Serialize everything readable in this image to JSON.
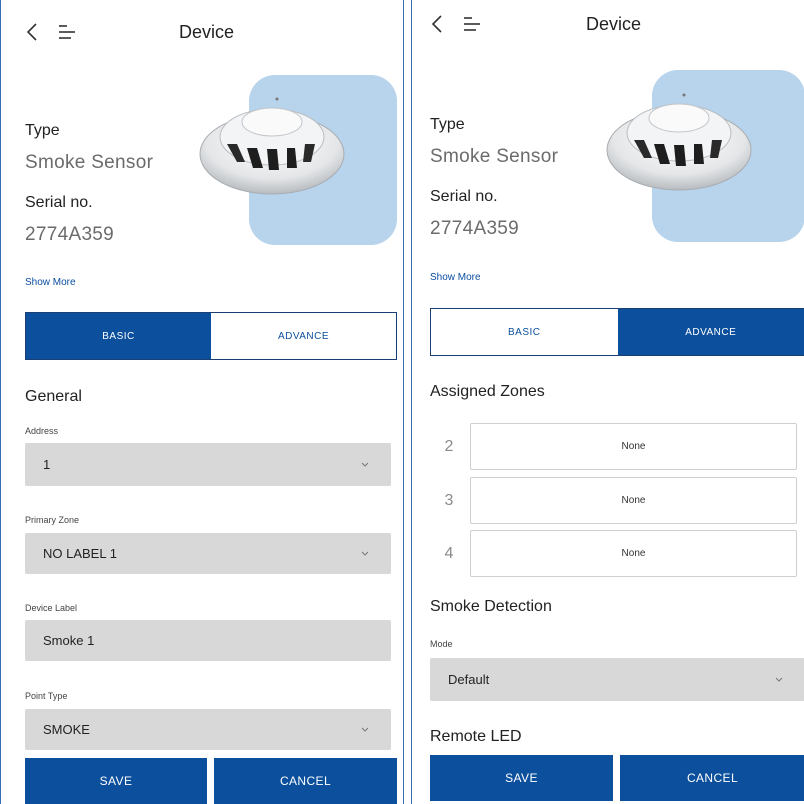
{
  "left": {
    "header": {
      "title": "Device"
    },
    "device": {
      "type_label": "Type",
      "type_value": "Smoke Sensor",
      "serial_label": "Serial no.",
      "serial_value": "2774A359",
      "show_more": "Show More"
    },
    "tabs": {
      "basic": "BASIC",
      "advance": "ADVANCE",
      "active": "basic"
    },
    "general": {
      "title": "General",
      "address_label": "Address",
      "address_value": "1",
      "primary_zone_label": "Primary Zone",
      "primary_zone_value": "NO LABEL 1",
      "device_label_label": "Device Label",
      "device_label_value": "Smoke 1",
      "point_type_label": "Point Type",
      "point_type_value": "SMOKE"
    },
    "buttons": {
      "save": "SAVE",
      "cancel": "CANCEL"
    }
  },
  "right": {
    "header": {
      "title": "Device"
    },
    "device": {
      "type_label": "Type",
      "type_value": "Smoke Sensor",
      "serial_label": "Serial no.",
      "serial_value": "2774A359",
      "show_more": "Show More"
    },
    "tabs": {
      "basic": "BASIC",
      "advance": "ADVANCE",
      "active": "advance"
    },
    "assigned_zones": {
      "title": "Assigned Zones",
      "zones": [
        {
          "number": "2",
          "value": "None"
        },
        {
          "number": "3",
          "value": "None"
        },
        {
          "number": "4",
          "value": "None"
        }
      ]
    },
    "smoke_detection": {
      "title": "Smoke Detection",
      "mode_label": "Mode",
      "mode_value": "Default"
    },
    "remote_led": {
      "title": "Remote LED"
    },
    "buttons": {
      "save": "SAVE",
      "cancel": "CANCEL"
    }
  },
  "icons": [
    "back-arrow-icon",
    "menu-lines-icon",
    "chevron-down-icon",
    "smoke-detector-image"
  ],
  "colors": {
    "primary": "#0c4f9c",
    "field_bg": "#d8d8d8",
    "image_bg": "#b8d3ec",
    "divider": "#3a6fb5"
  }
}
